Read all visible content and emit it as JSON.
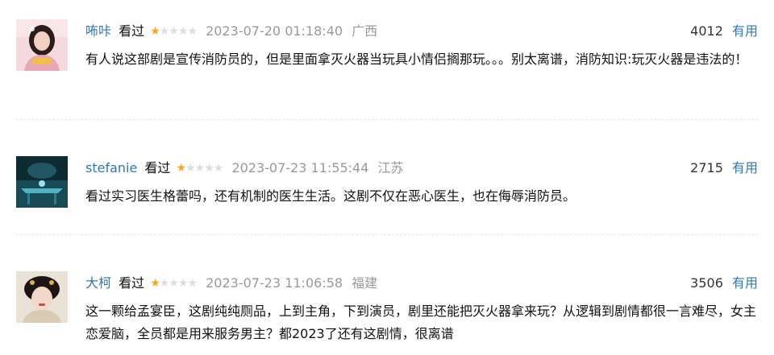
{
  "comments": [
    {
      "username": "咘咔",
      "status": "看过",
      "rating": 1,
      "rating_max": 5,
      "time": "2023-07-20 01:18:40",
      "region": "广西",
      "votes": "4012",
      "useful_label": "有用",
      "content": "有人说这部剧是宣传消防员的，但是里面拿灭火器当玩具小情侣搁那玩。。。别太离谱，消防知识:玩灭火器是违法的！"
    },
    {
      "username": "stefanie",
      "status": "看过",
      "rating": 1,
      "rating_max": 5,
      "time": "2023-07-23 11:55:44",
      "region": "江苏",
      "votes": "2715",
      "useful_label": "有用",
      "content": "看过实习医生格蕾吗，还有机制的医生生活。这剧不仅在恶心医生，也在侮辱消防员。"
    },
    {
      "username": "大柯",
      "status": "看过",
      "rating": 1,
      "rating_max": 5,
      "time": "2023-07-23 11:06:58",
      "region": "福建",
      "votes": "3506",
      "useful_label": "有用",
      "content": "这一颗给孟宴臣，这剧纯纯厕品，上到主角，下到演员，剧里还能把灭火器拿来玩？从逻辑到剧情都很一言难尽，女主恋爱脑，全员都是用来服务男主？都2023了还有这剧情，很离谱"
    }
  ],
  "colors": {
    "link": "#3377aa",
    "star_on": "#f5a623",
    "star_off": "#dddddd",
    "meta_gray": "#999999",
    "divider": "#e5e5e5"
  },
  "icons": {
    "star_filled": "star-filled-icon",
    "star_empty": "star-empty-icon"
  }
}
